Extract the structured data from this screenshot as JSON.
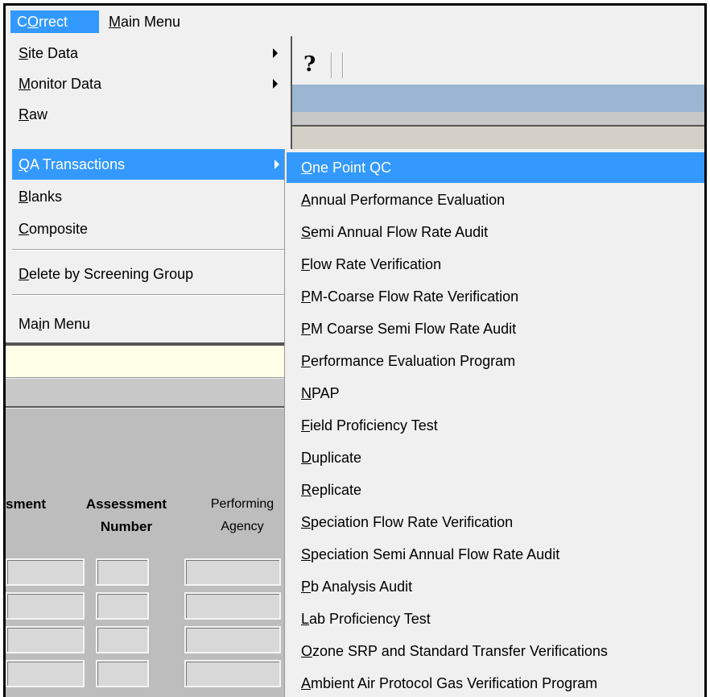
{
  "menubar": {
    "correct": {
      "pre": "C",
      "acc": "O",
      "post": "rrect"
    },
    "main_menu": {
      "pre": "",
      "acc": "M",
      "post": "ain Menu"
    }
  },
  "toolbar": {
    "help": "?"
  },
  "dropdown": {
    "items": [
      {
        "pre": "",
        "acc": "S",
        "post": "ite Data",
        "submenu": true
      },
      {
        "pre": "",
        "acc": "M",
        "post": "onitor Data",
        "submenu": true
      },
      {
        "pre": "",
        "acc": "R",
        "post": "aw",
        "submenu": false
      },
      {
        "pre": "",
        "acc": "Q",
        "post": "A Transactions",
        "submenu": true
      },
      {
        "pre": "",
        "acc": "B",
        "post": "lanks",
        "submenu": false
      },
      {
        "pre": "",
        "acc": "C",
        "post": "omposite",
        "submenu": false
      },
      {
        "pre": "",
        "acc": "D",
        "post": "elete by Screening Group",
        "submenu": false
      },
      {
        "pre": "Ma",
        "acc": "i",
        "post": "n Menu",
        "submenu": false
      }
    ]
  },
  "submenu": {
    "items": [
      {
        "pre": "",
        "acc": "O",
        "post": "ne Point QC"
      },
      {
        "pre": "",
        "acc": "A",
        "post": "nnual Performance Evaluation"
      },
      {
        "pre": "",
        "acc": "S",
        "post": "emi Annual Flow Rate Audit"
      },
      {
        "pre": "",
        "acc": "F",
        "post": "low Rate Verification"
      },
      {
        "pre": "",
        "acc": "P",
        "post": "M-Coarse Flow Rate Verification"
      },
      {
        "pre": "",
        "acc": "P",
        "post": "M Coarse Semi Flow Rate Audit"
      },
      {
        "pre": "",
        "acc": "P",
        "post": "erformance Evaluation Program"
      },
      {
        "pre": "",
        "acc": "N",
        "post": "PAP"
      },
      {
        "pre": "",
        "acc": "F",
        "post": "ield Proficiency Test"
      },
      {
        "pre": "",
        "acc": "D",
        "post": "uplicate"
      },
      {
        "pre": "",
        "acc": "R",
        "post": "eplicate"
      },
      {
        "pre": "",
        "acc": "S",
        "post": "peciation Flow Rate Verification"
      },
      {
        "pre": "",
        "acc": "S",
        "post": "peciation Semi Annual Flow Rate Audit"
      },
      {
        "pre": "",
        "acc": "P",
        "post": "b Analysis Audit"
      },
      {
        "pre": "",
        "acc": "L",
        "post": "ab Proficiency Test"
      },
      {
        "pre": "",
        "acc": "O",
        "post": "zone SRP and Standard Transfer Verifications"
      },
      {
        "pre": "",
        "acc": "A",
        "post": "mbient Air Protocol Gas Verification Program"
      }
    ]
  },
  "form": {
    "col1": "sment",
    "col2_line1": "Assessment",
    "col2_line2": "Number",
    "col3_line1": "Performing",
    "col3_line2": "Agency"
  }
}
